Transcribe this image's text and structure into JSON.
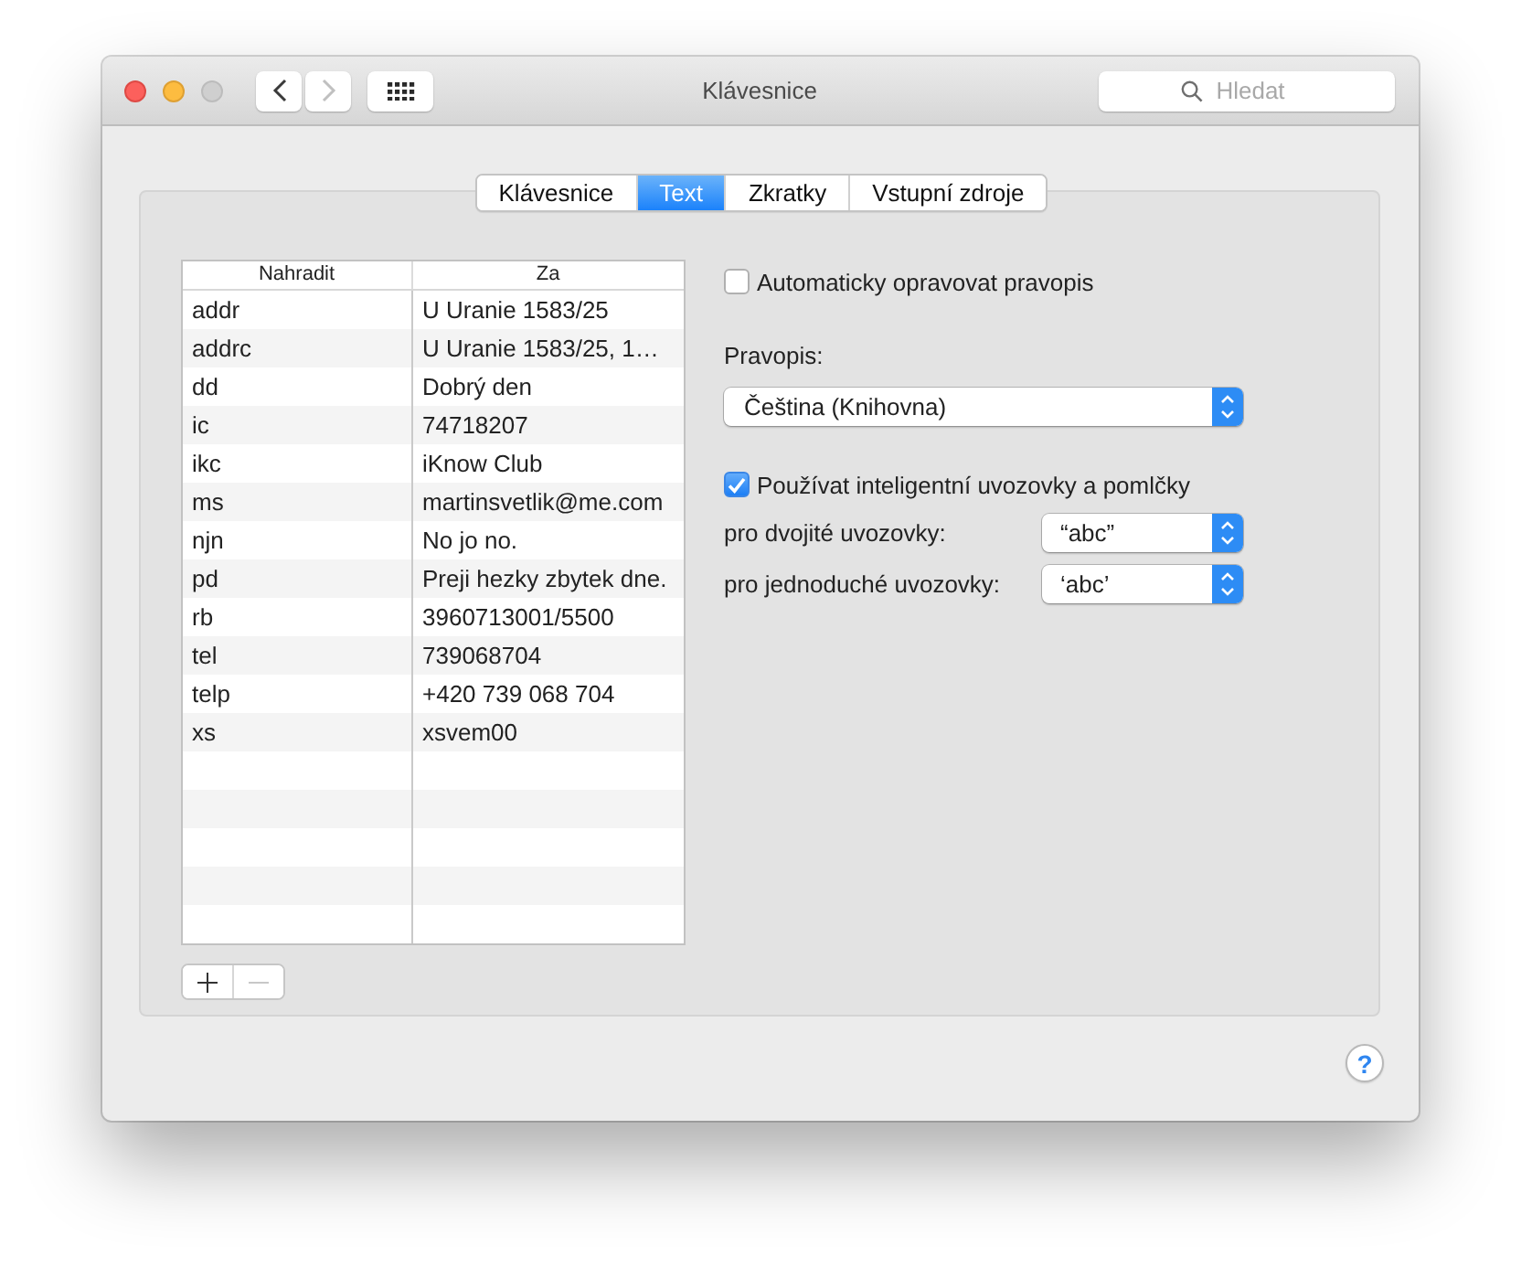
{
  "window": {
    "title": "Klávesnice",
    "search": {
      "placeholder": "Hledat"
    }
  },
  "window_controls": [
    {
      "kind": "close",
      "disabled": false
    },
    {
      "kind": "minimize",
      "disabled": false
    },
    {
      "kind": "zoom",
      "disabled": true
    }
  ],
  "nav_buttons": [
    {
      "kind": "back",
      "disabled": false
    },
    {
      "kind": "forward",
      "disabled": true
    }
  ],
  "tabs": [
    {
      "label": "Klávesnice",
      "selected": false
    },
    {
      "label": "Text",
      "selected": true
    },
    {
      "label": "Zkratky",
      "selected": false
    },
    {
      "label": "Vstupní zdroje",
      "selected": false
    }
  ],
  "replacements": {
    "columns": [
      "Nahradit",
      "Za"
    ],
    "rows": [
      {
        "replace": "addr",
        "with": "U Uranie 1583/25"
      },
      {
        "replace": "addrc",
        "with": "U Uranie 1583/25, 1…"
      },
      {
        "replace": "dd",
        "with": "Dobrý den"
      },
      {
        "replace": "ic",
        "with": "74718207"
      },
      {
        "replace": "ikc",
        "with": "iKnow Club"
      },
      {
        "replace": "ms",
        "with": "martinsvetlik@me.com"
      },
      {
        "replace": "njn",
        "with": "No jo no."
      },
      {
        "replace": "pd",
        "with": "Preji hezky zbytek dne."
      },
      {
        "replace": "rb",
        "with": "3960713001/5500"
      },
      {
        "replace": "tel",
        "with": "739068704"
      },
      {
        "replace": "telp",
        "with": "+420 739 068 704"
      },
      {
        "replace": "xs",
        "with": "xsvem00"
      }
    ]
  },
  "list_buttons": [
    {
      "kind": "add",
      "disabled": false
    },
    {
      "kind": "remove",
      "disabled": true
    }
  ],
  "spelling_autocorrect": {
    "label": "Automaticky opravovat pravopis",
    "checked": false
  },
  "spelling": {
    "label": "Pravopis:",
    "value": "Čeština (Knihovna)"
  },
  "smart_quotes": {
    "label": "Používat inteligentní uvozovky a pomlčky",
    "checked": true,
    "options": [
      {
        "label": "pro dvojité uvozovky:",
        "value": "“abc”"
      },
      {
        "label": "pro jednoduché uvozovky:",
        "value": "‘abc’"
      }
    ]
  },
  "help_button": {
    "label": "?"
  }
}
